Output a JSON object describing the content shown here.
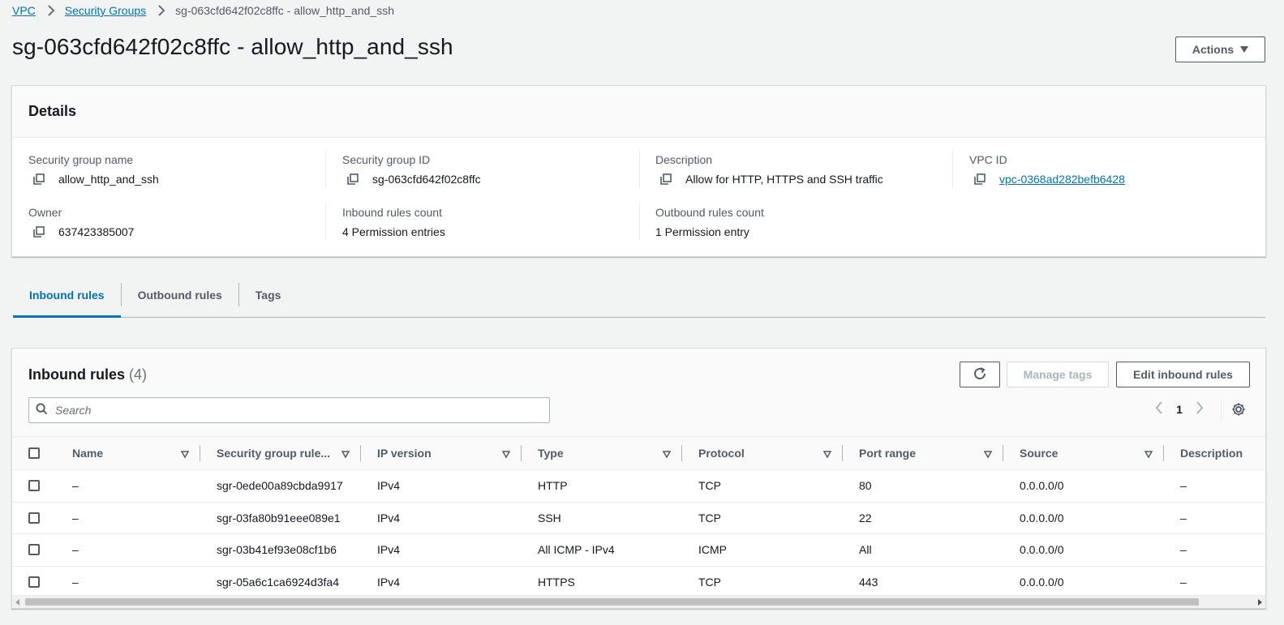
{
  "breadcrumb": {
    "vpc": "VPC",
    "security_groups": "Security Groups",
    "current": "sg-063cfd642f02c8ffc - allow_http_and_ssh"
  },
  "page": {
    "title": "sg-063cfd642f02c8ffc - allow_http_and_ssh",
    "actions_label": "Actions"
  },
  "details": {
    "heading": "Details",
    "sg_name_label": "Security group name",
    "sg_name_value": "allow_http_and_ssh",
    "sg_id_label": "Security group ID",
    "sg_id_value": "sg-063cfd642f02c8ffc",
    "description_label": "Description",
    "description_value": "Allow for HTTP, HTTPS and SSH traffic",
    "vpc_id_label": "VPC ID",
    "vpc_id_value": "vpc-0368ad282befb6428",
    "owner_label": "Owner",
    "owner_value": "637423385007",
    "inbound_count_label": "Inbound rules count",
    "inbound_count_value": "4 Permission entries",
    "outbound_count_label": "Outbound rules count",
    "outbound_count_value": "1 Permission entry"
  },
  "tabs": [
    {
      "label": "Inbound rules",
      "active": true
    },
    {
      "label": "Outbound rules",
      "active": false
    },
    {
      "label": "Tags",
      "active": false
    }
  ],
  "inbound": {
    "title": "Inbound rules",
    "count": "(4)",
    "manage_tags_label": "Manage tags",
    "edit_label": "Edit inbound rules",
    "search_placeholder": "Search",
    "page_number": "1",
    "columns": [
      "Name",
      "Security group rule...",
      "IP version",
      "Type",
      "Protocol",
      "Port range",
      "Source",
      "Description"
    ],
    "rows": [
      {
        "name": "–",
        "rule_id": "sgr-0ede00a89cbda9917",
        "ip_version": "IPv4",
        "type": "HTTP",
        "protocol": "TCP",
        "port_range": "80",
        "source": "0.0.0.0/0",
        "description": "–"
      },
      {
        "name": "–",
        "rule_id": "sgr-03fa80b91eee089e1",
        "ip_version": "IPv4",
        "type": "SSH",
        "protocol": "TCP",
        "port_range": "22",
        "source": "0.0.0.0/0",
        "description": "–"
      },
      {
        "name": "–",
        "rule_id": "sgr-03b41ef93e08cf1b6",
        "ip_version": "IPv4",
        "type": "All ICMP - IPv4",
        "protocol": "ICMP",
        "port_range": "All",
        "source": "0.0.0.0/0",
        "description": "–"
      },
      {
        "name": "–",
        "rule_id": "sgr-05a6c1ca6924d3fa4",
        "ip_version": "IPv4",
        "type": "HTTPS",
        "protocol": "TCP",
        "port_range": "443",
        "source": "0.0.0.0/0",
        "description": "–"
      }
    ]
  },
  "colors": {
    "link": "#0073bb",
    "text": "#16191f",
    "muted": "#545b64",
    "background": "#f2f3f3"
  }
}
